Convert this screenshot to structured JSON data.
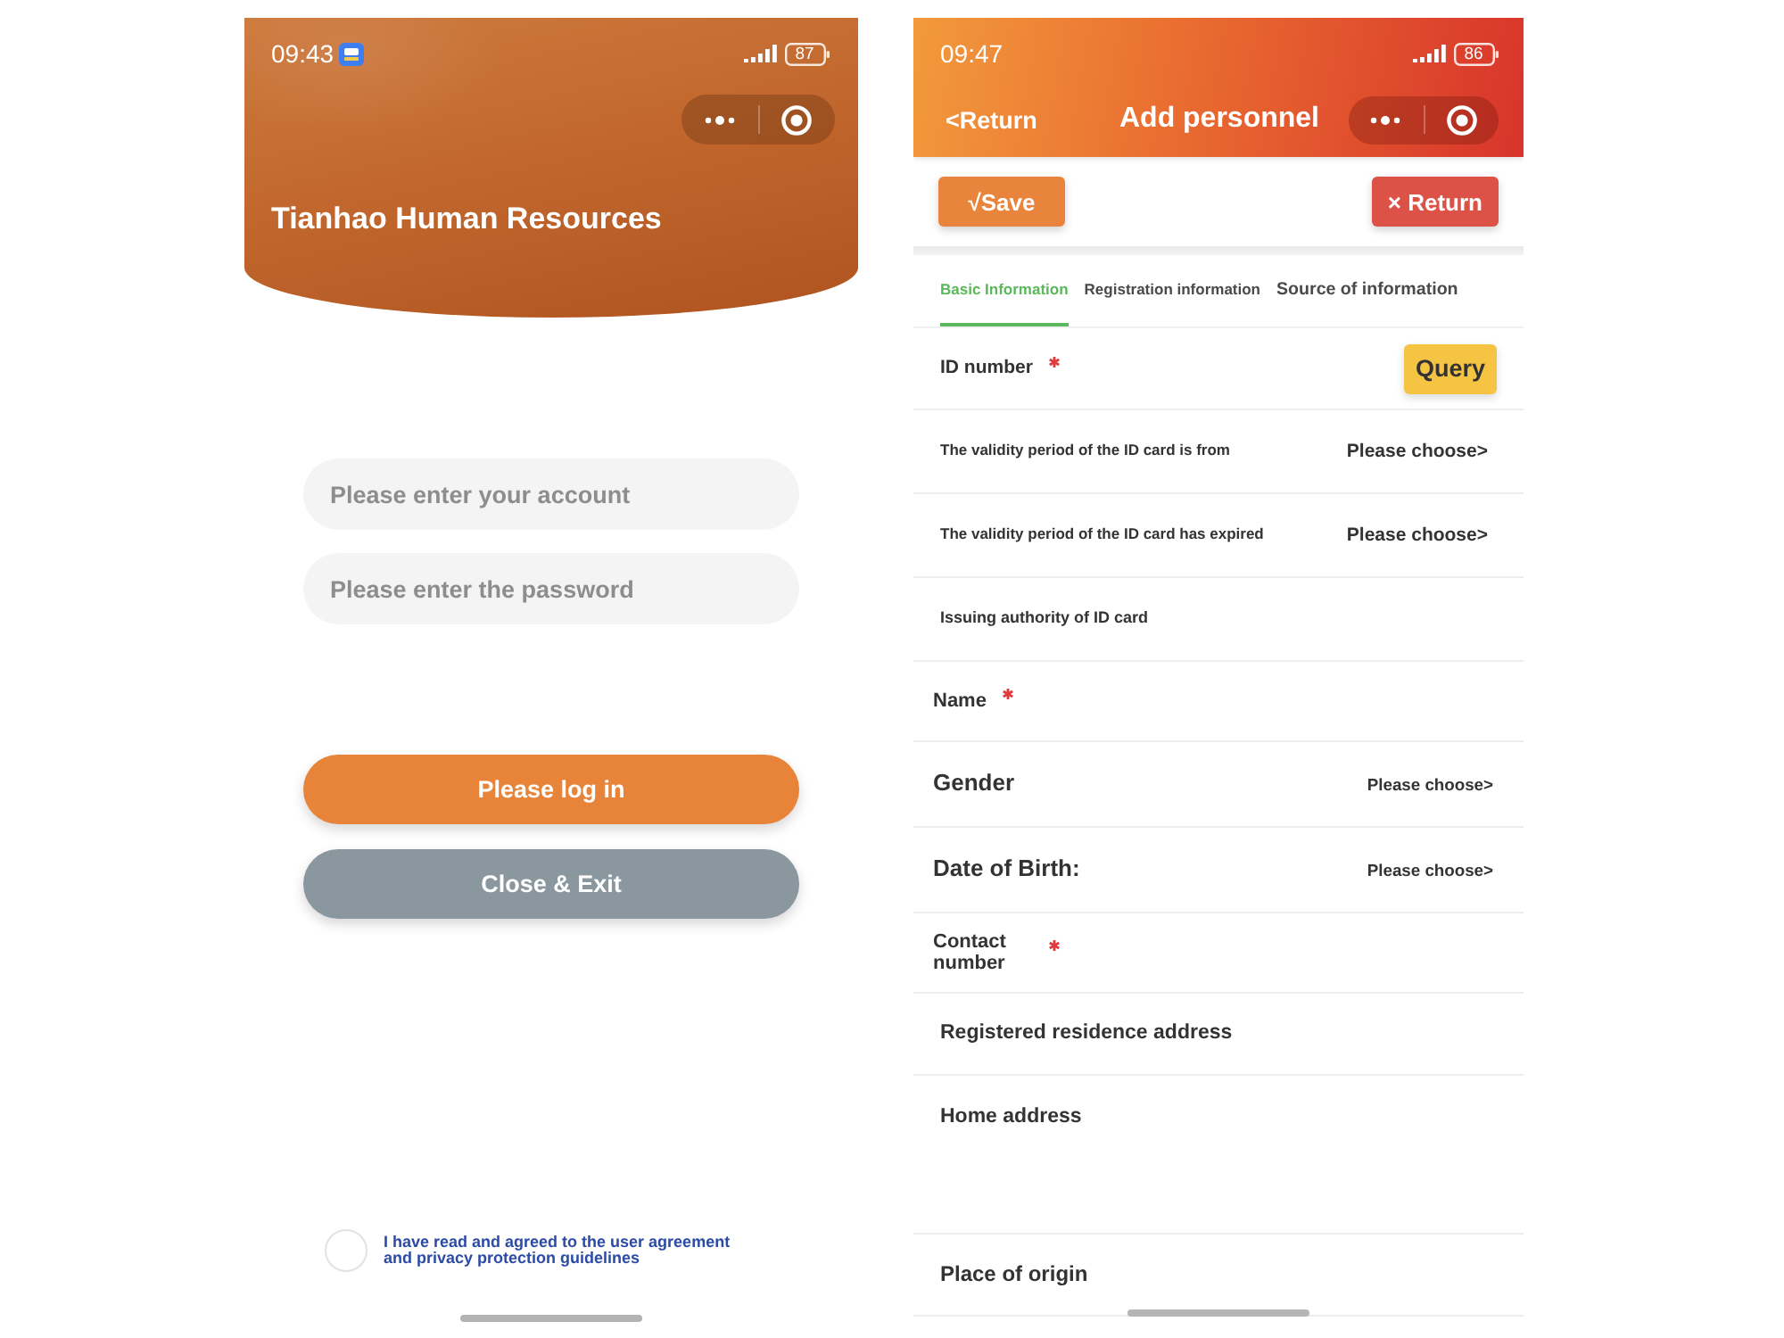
{
  "login_screen": {
    "status_bar": {
      "time": "09:43",
      "battery": "87"
    },
    "title": "Tianhao Human Resources",
    "fields": [
      {
        "placeholder": "Please enter your account"
      },
      {
        "placeholder": "Please enter the password"
      }
    ],
    "buttons": [
      {
        "label": "Please log in",
        "kind": "primary"
      },
      {
        "label": "Close & Exit",
        "kind": "secondary"
      }
    ],
    "agreement": {
      "checked": false,
      "text": "I have read and agreed to the user agreement and privacy protection guidelines"
    }
  },
  "form_screen": {
    "status_bar": {
      "time": "09:47",
      "battery": "86"
    },
    "nav": {
      "back": "<Return",
      "title": "Add personnel"
    },
    "actions": [
      {
        "label": "√Save",
        "kind": "save"
      },
      {
        "label": "× Return",
        "kind": "cancel"
      }
    ],
    "tabs": [
      {
        "label": "Basic Information",
        "selected": true
      },
      {
        "label": "Registration information",
        "selected": false
      },
      {
        "label": "Source of information",
        "selected": false
      }
    ],
    "fields": [
      {
        "label": "ID number",
        "required": true,
        "kind": "query",
        "action": "Query"
      },
      {
        "label": "The validity period of the ID card is from",
        "required": false,
        "kind": "picker",
        "picker": "Please choose>"
      },
      {
        "label": "The validity period of the ID card has expired",
        "required": false,
        "kind": "picker",
        "picker": "Please choose>"
      },
      {
        "label": "Issuing authority of ID card",
        "required": false,
        "kind": "text"
      },
      {
        "label": "Name",
        "required": true,
        "kind": "text"
      },
      {
        "label": "Gender",
        "required": false,
        "kind": "picker",
        "picker": "Please choose>"
      },
      {
        "label": "Date of Birth:",
        "required": false,
        "kind": "picker",
        "picker": "Please choose>"
      },
      {
        "label": "Contact number",
        "required": true,
        "kind": "text"
      },
      {
        "label": "Registered residence address",
        "required": false,
        "kind": "text"
      },
      {
        "label": "Home address",
        "required": false,
        "kind": "textarea"
      },
      {
        "label": "Place of origin",
        "required": false,
        "kind": "text"
      }
    ]
  }
}
